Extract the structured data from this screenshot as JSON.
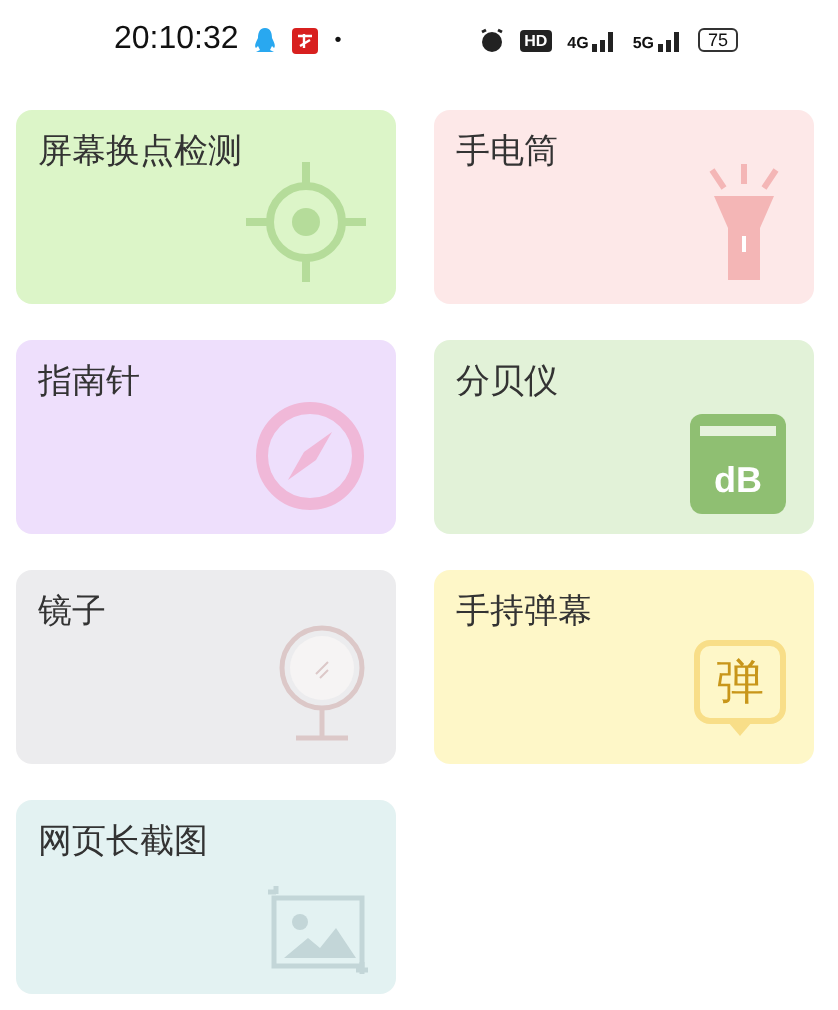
{
  "status_bar": {
    "time": "20:10:32",
    "notification_dot": "•",
    "hd": "HD",
    "network_1": "4G",
    "network_2": "5G",
    "battery": "75"
  },
  "tools": [
    {
      "label": "屏幕换点检测",
      "kind": "crosshair",
      "color": "#dcf5c8"
    },
    {
      "label": "手电筒",
      "kind": "flashlight",
      "color": "#fde8e8"
    },
    {
      "label": "指南针",
      "kind": "compass",
      "color": "#eedffc"
    },
    {
      "label": "分贝仪",
      "kind": "decibel",
      "color": "#e2f2d8",
      "icon_text": "dB"
    },
    {
      "label": "镜子",
      "kind": "mirror",
      "color": "#ececee"
    },
    {
      "label": "手持弹幕",
      "kind": "danmaku",
      "color": "#fef7c8",
      "icon_text": "弹"
    },
    {
      "label": "网页长截图",
      "kind": "image",
      "color": "#e3f2f2"
    }
  ]
}
